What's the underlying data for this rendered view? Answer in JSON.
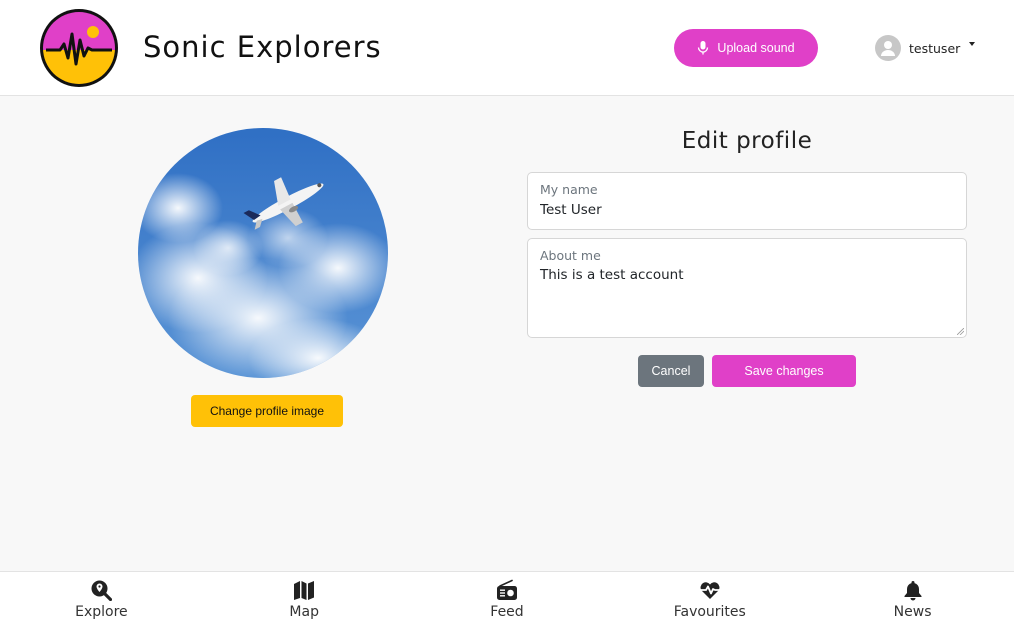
{
  "header": {
    "brand": "Sonic Explorers",
    "upload_label": "Upload sound",
    "username": "testuser"
  },
  "profile": {
    "change_image_label": "Change profile image"
  },
  "form": {
    "title": "Edit profile",
    "name_label": "My name",
    "name_value": "Test User",
    "about_label": "About me",
    "about_value": "This is a test account",
    "cancel_label": "Cancel",
    "save_label": "Save changes"
  },
  "nav": {
    "items": [
      {
        "label": "Explore",
        "icon": "search-location-icon"
      },
      {
        "label": "Map",
        "icon": "map-icon"
      },
      {
        "label": "Feed",
        "icon": "radio-icon"
      },
      {
        "label": "Favourites",
        "icon": "heartbeat-icon"
      },
      {
        "label": "News",
        "icon": "bell-icon"
      }
    ]
  },
  "colors": {
    "accent": "#e040c8",
    "warning": "#ffc107",
    "secondary": "#6c757d",
    "logo_ring": "#111111",
    "logo_top": "#e040c8",
    "logo_bottom": "#ffc107"
  }
}
